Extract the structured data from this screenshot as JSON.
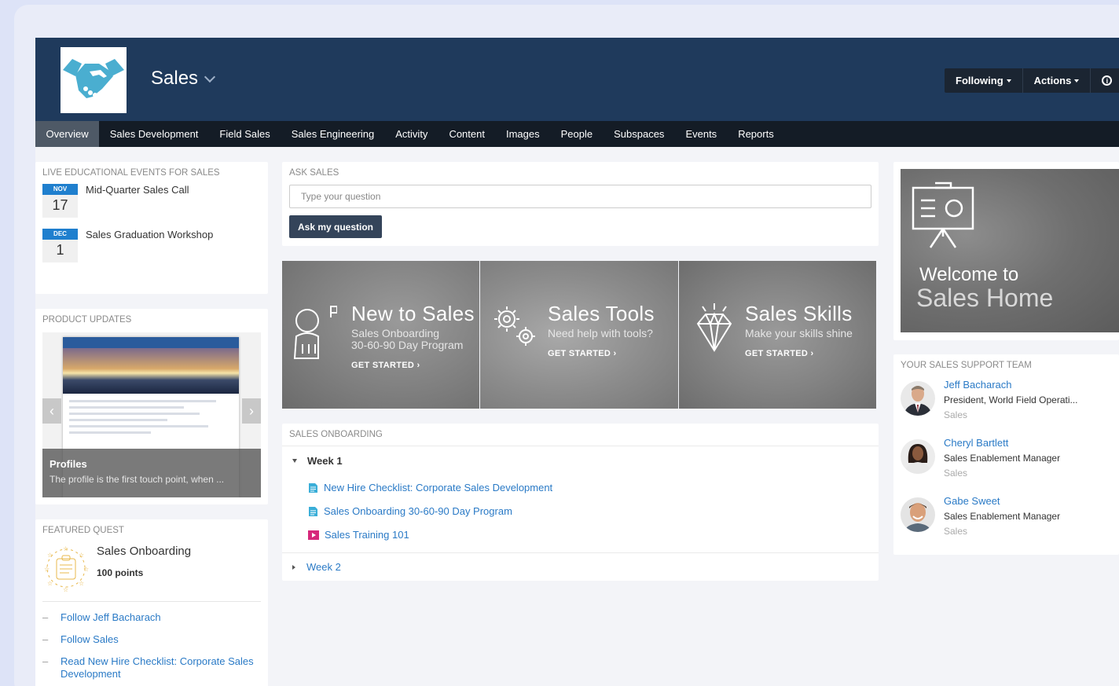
{
  "header": {
    "space_name": "Sales",
    "following_label": "Following",
    "actions_label": "Actions",
    "info_glyph": "i"
  },
  "nav": {
    "items": [
      "Overview",
      "Sales Development",
      "Field Sales",
      "Sales Engineering",
      "Activity",
      "Content",
      "Images",
      "People",
      "Subspaces",
      "Events",
      "Reports"
    ],
    "active": "Overview"
  },
  "events": {
    "title": "LIVE EDUCATIONAL EVENTS FOR SALES",
    "items": [
      {
        "month": "NOV",
        "day": "17",
        "name": "Mid-Quarter Sales Call"
      },
      {
        "month": "DEC",
        "day": "1",
        "name": "Sales Graduation Workshop"
      }
    ]
  },
  "updates": {
    "title": "PRODUCT UPDATES",
    "caption_title": "Profiles",
    "caption_text": "The profile is the first touch point, when ..."
  },
  "quest": {
    "title": "FEATURED QUEST",
    "name": "Sales Onboarding",
    "points": "100 points",
    "tasks": [
      "Follow Jeff Bacharach",
      "Follow Sales",
      "Read New Hire Checklist: Corporate Sales Development"
    ]
  },
  "ask": {
    "title": "ASK SALES",
    "placeholder": "Type your question",
    "button_label": "Ask my question"
  },
  "tiles": [
    {
      "title": "New to Sales",
      "subtitle_1": "Sales Onboarding",
      "subtitle_2": "30-60-90 Day Program",
      "cta": "GET STARTED ›"
    },
    {
      "title": "Sales Tools",
      "subtitle_1": "Need help with tools?",
      "cta": "GET STARTED ›"
    },
    {
      "title": "Sales Skills",
      "subtitle_1": "Make your skills shine",
      "cta": "GET STARTED ›"
    }
  ],
  "onboarding": {
    "title": "SALES ONBOARDING",
    "week1_label": "Week 1",
    "week2_label": "Week 2",
    "docs": [
      {
        "label": "New Hire Checklist: Corporate Sales Development",
        "type": "document"
      },
      {
        "label": "Sales Onboarding 30-60-90 Day Program",
        "type": "document"
      },
      {
        "label": "Sales Training 101",
        "type": "video"
      }
    ]
  },
  "welcome": {
    "line1": "Welcome to",
    "line2": "Sales Home"
  },
  "team": {
    "title": "YOUR SALES SUPPORT TEAM",
    "members": [
      {
        "name": "Jeff Bacharach",
        "title": "President, World Field Operati...",
        "group": "Sales"
      },
      {
        "name": "Cheryl Bartlett",
        "title": "Sales Enablement Manager",
        "group": "Sales"
      },
      {
        "name": "Gabe Sweet",
        "title": "Sales Enablement Manager",
        "group": "Sales"
      }
    ]
  },
  "colors": {
    "banner": "#1f3a5c",
    "nav": "#141c26",
    "link": "#2a7ac6",
    "date_badge": "#1f7fce",
    "logo_accent": "#4aaed0",
    "video_icon": "#d6287b"
  }
}
